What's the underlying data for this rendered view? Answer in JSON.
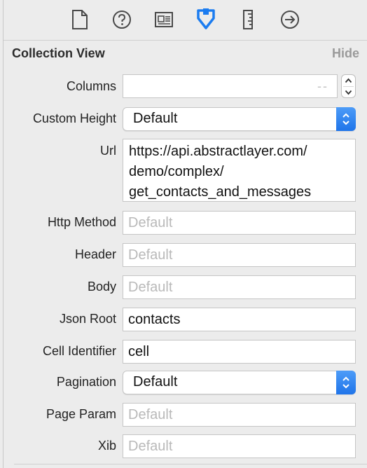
{
  "toolbar": {
    "tabs": [
      {
        "icon": "file-icon"
      },
      {
        "icon": "help-icon"
      },
      {
        "icon": "identity-card-icon"
      },
      {
        "icon": "attributes-icon",
        "active": true
      },
      {
        "icon": "ruler-icon"
      },
      {
        "icon": "arrow-circle-icon"
      }
    ],
    "active_color": "#1b7cf0",
    "icon_color": "#4a4a4a"
  },
  "section": {
    "title": "Collection View",
    "hide_label": "Hide"
  },
  "fields": {
    "columns": {
      "label": "Columns",
      "placeholder": "-- "
    },
    "custom_height": {
      "label": "Custom Height",
      "value": "Default"
    },
    "url": {
      "label": "Url",
      "lines": [
        "https://api.abstractlayer.com/",
        "demo/complex/",
        "get_contacts_and_messages"
      ]
    },
    "http_method": {
      "label": "Http Method",
      "placeholder": "Default"
    },
    "header": {
      "label": "Header",
      "placeholder": "Default"
    },
    "body": {
      "label": "Body",
      "placeholder": "Default"
    },
    "json_root": {
      "label": "Json Root",
      "value": "contacts"
    },
    "cell_identifier": {
      "label": "Cell Identifier",
      "value": "cell"
    },
    "pagination": {
      "label": "Pagination",
      "value": "Default"
    },
    "page_param": {
      "label": "Page Param",
      "placeholder": "Default"
    },
    "xib": {
      "label": "Xib",
      "placeholder": "Default"
    }
  }
}
